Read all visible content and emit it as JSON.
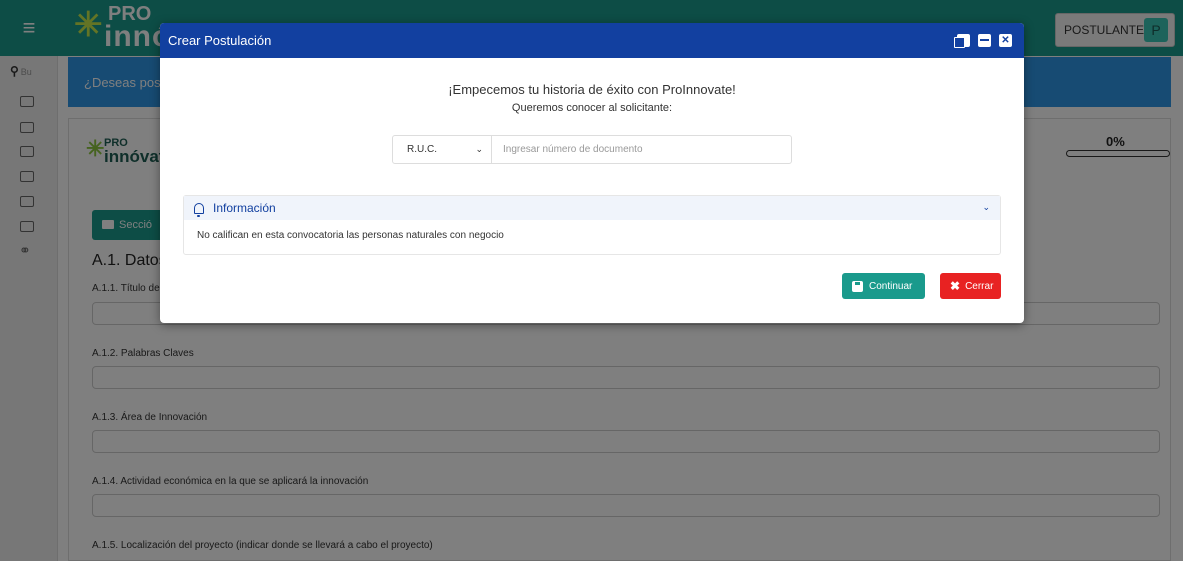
{
  "app": {
    "logo_pro": "PRO",
    "logo_inno": "innó",
    "user_role": "POSTULANTE",
    "user_initial": "P"
  },
  "sidebar": {
    "search_placeholder": "Bu"
  },
  "banner": {
    "text": "¿Deseas post"
  },
  "form": {
    "logo_pro": "PRO",
    "logo_inno": "innóvat",
    "progress": "0%",
    "section_button": "Secció",
    "section_title": "A.1. Datos",
    "fields": [
      {
        "label": "A.1.1. Título de"
      },
      {
        "label": "A.1.2. Palabras Claves"
      },
      {
        "label": "A.1.3. Área de Innovación"
      },
      {
        "label": "A.1.4. Actividad económica en la que se aplicará la innovación"
      },
      {
        "label": "A.1.5. Localización del proyecto (indicar donde se llevará a cabo el proyecto)"
      }
    ]
  },
  "modal": {
    "title": "Crear Postulación",
    "heading": "¡Empecemos tu historia de éxito con ProInnovate!",
    "subheading": "Queremos conocer al solicitante:",
    "doc_type": "R.U.C.",
    "doc_placeholder": "Ingresar número de documento",
    "info_title": "Información",
    "info_text": "No califican en esta convocatoria las personas naturales con negocio",
    "continue_label": "Continuar",
    "close_label": "Cerrar"
  },
  "colors": {
    "header_blue": "#1240a0",
    "teal": "#1a9a8c",
    "red": "#e82222",
    "banner_blue": "#2f96e6"
  }
}
